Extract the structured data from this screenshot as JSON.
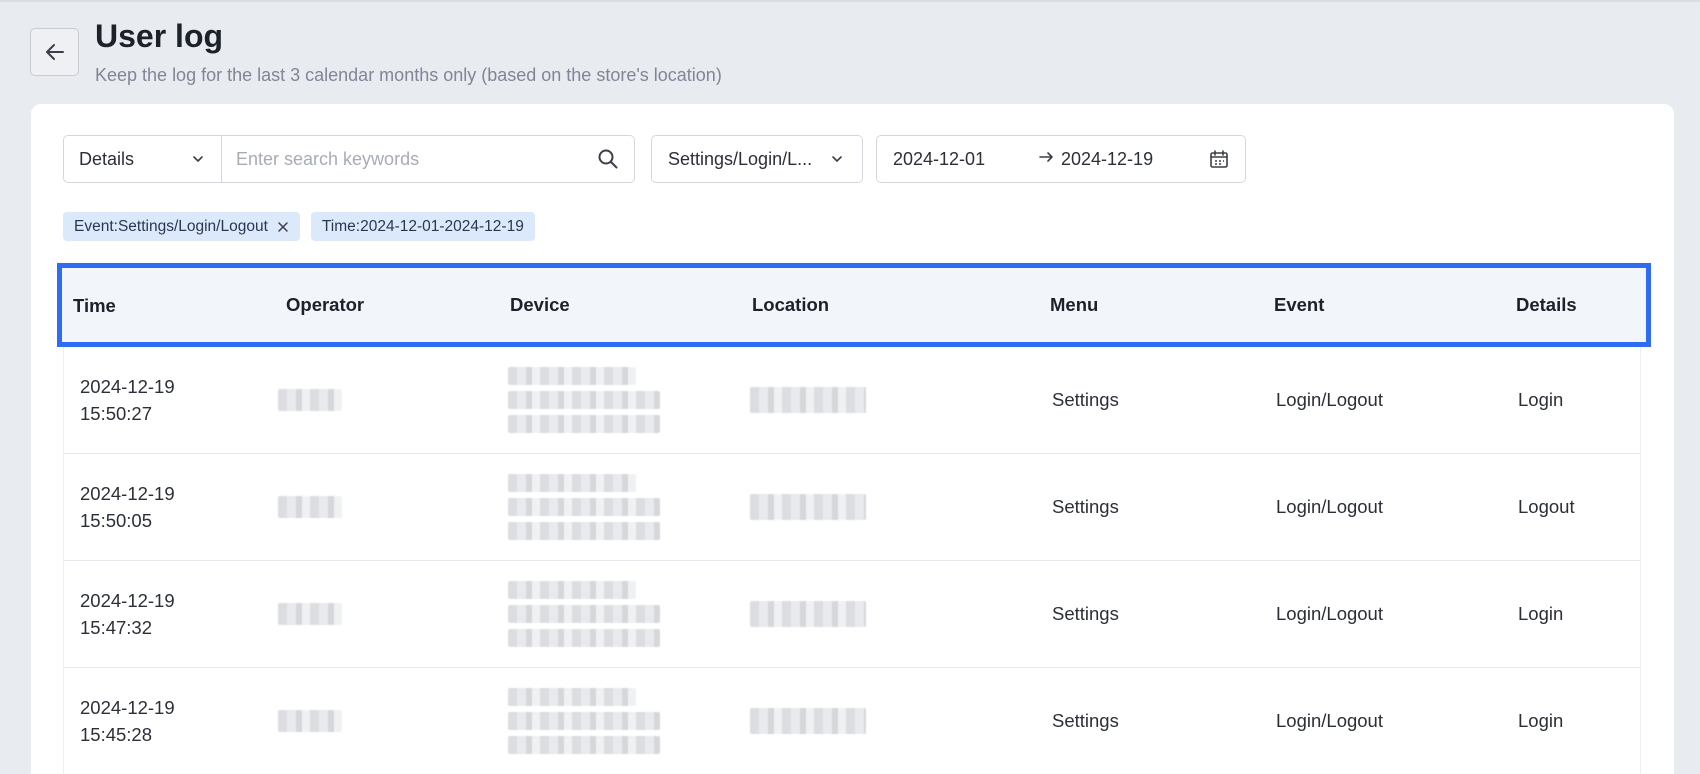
{
  "header": {
    "title": "User log",
    "subtitle": "Keep the log for the last 3 calendar months only (based on the store's location)"
  },
  "filters": {
    "search_type": "Details",
    "search_placeholder": "Enter search keywords",
    "event_select": "Settings/Login/L...",
    "date_start": "2024-12-01",
    "date_end": "2024-12-19"
  },
  "tags": [
    {
      "label": "Event:Settings/Login/Logout",
      "closable": true
    },
    {
      "label": "Time:2024-12-01-2024-12-19",
      "closable": false
    }
  ],
  "table": {
    "columns": [
      "Time",
      "Operator",
      "Device",
      "Location",
      "Menu",
      "Event",
      "Details"
    ],
    "rows": [
      {
        "date": "2024-12-19",
        "time": "15:50:27",
        "menu": "Settings",
        "event": "Login/Logout",
        "details": "Login"
      },
      {
        "date": "2024-12-19",
        "time": "15:50:05",
        "menu": "Settings",
        "event": "Login/Logout",
        "details": "Logout"
      },
      {
        "date": "2024-12-19",
        "time": "15:47:32",
        "menu": "Settings",
        "event": "Login/Logout",
        "details": "Login"
      },
      {
        "date": "2024-12-19",
        "time": "15:45:28",
        "menu": "Settings",
        "event": "Login/Logout",
        "details": "Login"
      }
    ]
  },
  "colors": {
    "highlight_border": "#2f6cf3",
    "tag_bg": "#dce9fb",
    "page_bg": "#e8ebf0"
  },
  "icons": [
    "back-arrow-icon",
    "chevron-down-icon",
    "search-icon",
    "arrow-right-icon",
    "calendar-icon",
    "close-icon"
  ]
}
